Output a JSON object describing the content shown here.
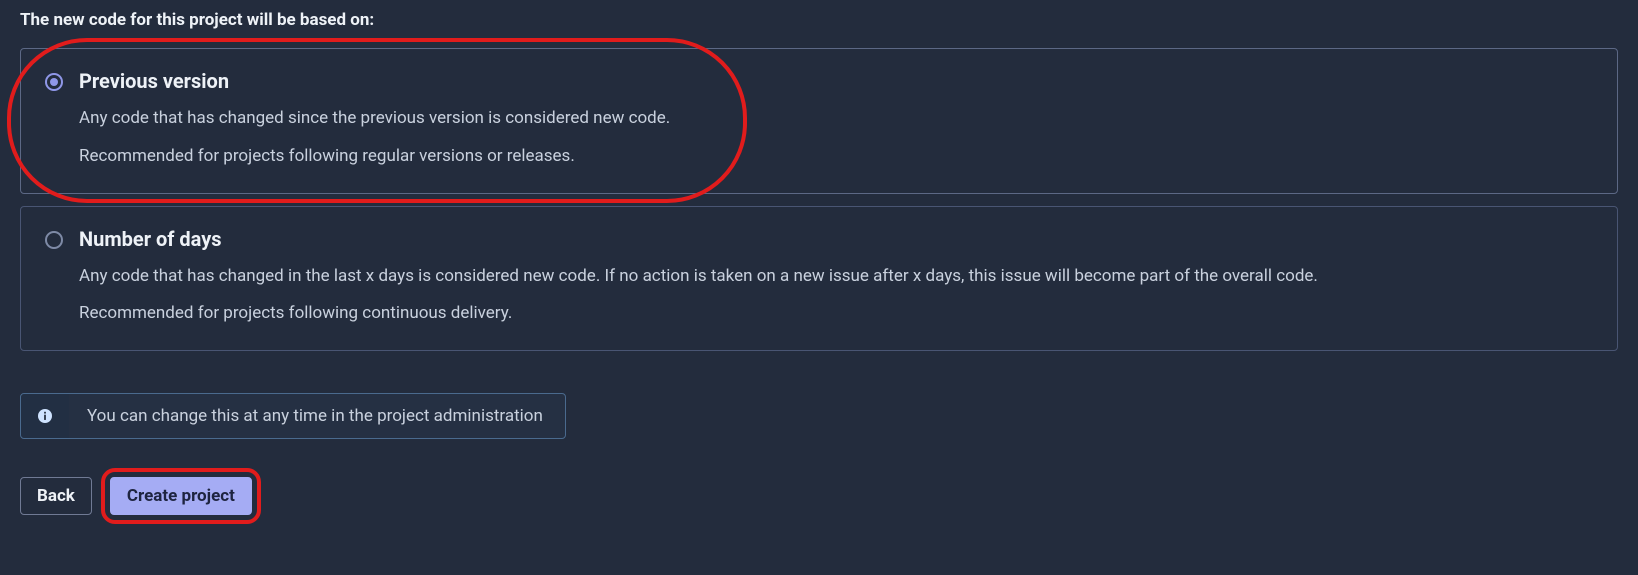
{
  "section_title": "The new code for this project will be based on:",
  "options": [
    {
      "selected": true,
      "title": "Previous version",
      "line1": "Any code that has changed since the previous version is considered new code.",
      "line2": "Recommended for projects following regular versions or releases."
    },
    {
      "selected": false,
      "title": "Number of days",
      "line1": "Any code that has changed in the last x days is considered new code. If no action is taken on a new issue after x days, this issue will become part of the overall code.",
      "line2": "Recommended for projects following continuous delivery."
    }
  ],
  "info": {
    "icon_name": "info-icon",
    "text": "You can change this at any time in the project administration"
  },
  "buttons": {
    "back": "Back",
    "create": "Create project"
  },
  "annotations": {
    "option_highlight_index": 0,
    "button_highlight": "create"
  }
}
